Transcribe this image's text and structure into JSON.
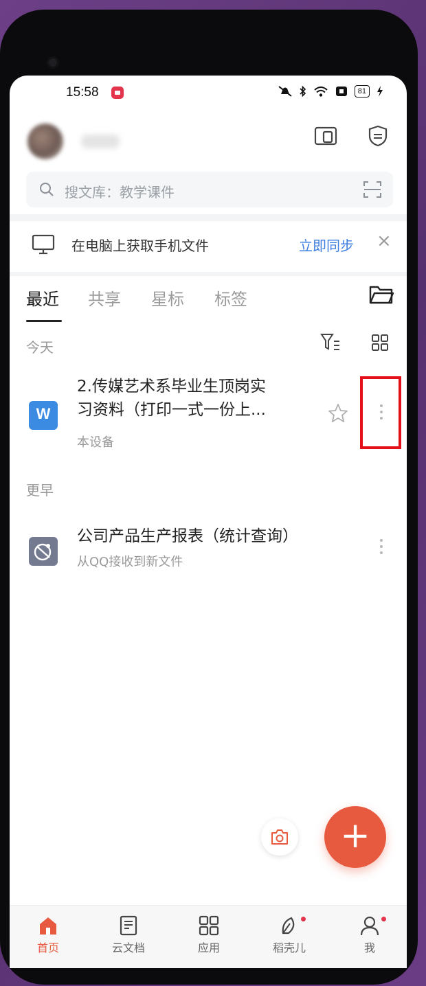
{
  "status_bar": {
    "time": "15:58",
    "battery": "81"
  },
  "search": {
    "placeholder": "搜文库：教学课件"
  },
  "sync_banner": {
    "text": "在电脑上获取手机文件",
    "action": "立即同步",
    "close": "×"
  },
  "tabs": [
    {
      "label": "最近",
      "active": true
    },
    {
      "label": "共享",
      "active": false
    },
    {
      "label": "星标",
      "active": false
    },
    {
      "label": "标签",
      "active": false
    }
  ],
  "sections": {
    "today": "今天",
    "earlier": "更早"
  },
  "files": [
    {
      "icon": "W",
      "title_line1": "2.传媒艺术系毕业生顶岗实",
      "title_line2": "习资料（打印一式一份上...",
      "source": "本设备"
    },
    {
      "title": "公司产品生产报表（统计查询）",
      "source": "从QQ接收到新文件"
    }
  ],
  "fab": {
    "label": "+"
  },
  "bottom_nav": [
    {
      "label": "首页",
      "active": true
    },
    {
      "label": "云文档",
      "active": false
    },
    {
      "label": "应用",
      "active": false
    },
    {
      "label": "稻壳儿",
      "active": false
    },
    {
      "label": "我",
      "active": false
    }
  ],
  "colors": {
    "accent": "#e85a3f",
    "link": "#3b7de0",
    "highlight": "#e3101a",
    "word_blue": "#3c8be3"
  }
}
